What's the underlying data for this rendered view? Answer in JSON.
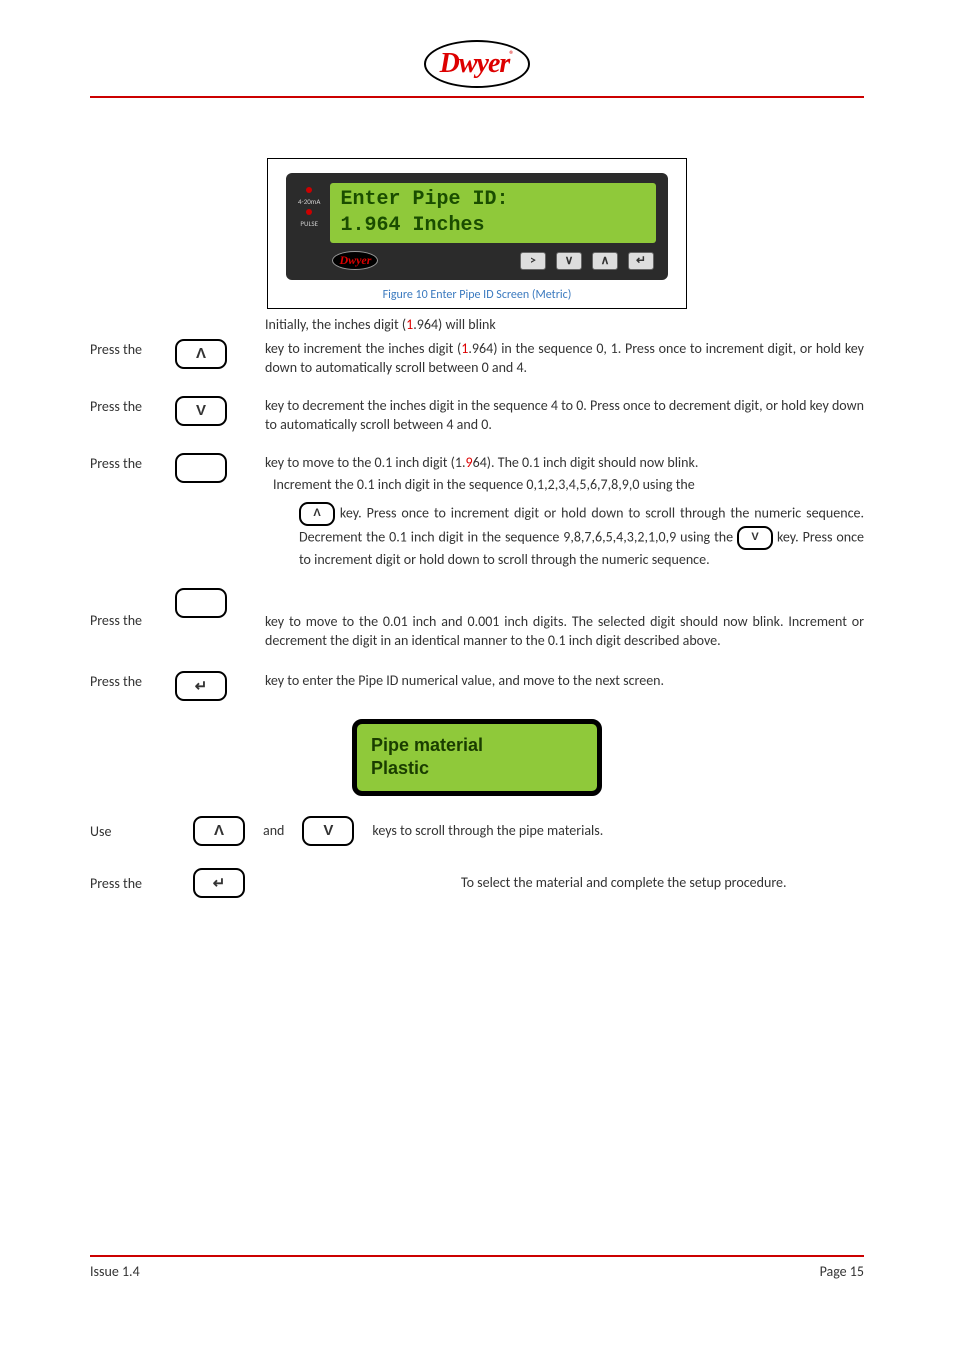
{
  "header": {
    "logo_text": "Dwyer",
    "logo_reg": "®"
  },
  "device": {
    "indicator1": "4-20mA",
    "indicator2": "PULSE",
    "lcd_line1": "Enter Pipe ID:",
    "lcd_line2": " 1.964 Inches",
    "mini_logo": "Dwyer",
    "btn_gt": ">",
    "btn_down": "∨",
    "btn_up": "∧",
    "btn_enter": "↵",
    "caption": "Figure 10 Enter Pipe ID Screen (Metric)"
  },
  "lines": {
    "initial": "Initially, the inches digit  (",
    "initial_red": "1",
    "initial_after": ".964) will blink",
    "press_the": "Press the",
    "use": "Use",
    "and": "and",
    "key_up": "Λ",
    "key_down": "V",
    "key_enter": "↵",
    "p1a": "key to increment the inches digit (",
    "p1_red": "1",
    "p1b": ".964) in the sequence 0, 1.  Press once to increment digit, or hold key down to automatically scroll between 0 and 4.",
    "p2": "key to decrement the inches digit in the sequence 4 to 0. Press once to decrement digit, or hold key down to automatically scroll between 4 and 0.",
    "p3a": "key to move to the 0.1 inch digit (1.",
    "p3_red": "9",
    "p3b": "64). The 0.1 inch digit should now blink.",
    "p3c": "Increment the 0.1 inch digit in the sequence 0,1,2,3,4,5,6,7,8,9,0 using the",
    "p3d": " key. Press once to increment digit or hold down to scroll through the numeric sequence. Decrement the 0.1 inch digit in the sequence 9,8,7,6,5,4,3,2,1,0,9 using the ",
    "p3e": " key.  Press once to increment digit or hold down to scroll through the numeric sequence.",
    "p4": "key to move to the 0.01 inch and 0.001 inch digits. The selected digit should now blink.  Increment or decrement the digit in an identical manner to the 0.1 inch digit described above.",
    "p5": "key to enter the Pipe ID numerical value, and move to the next screen.",
    "pipe_mat_l1": "Pipe material",
    "pipe_mat_l2": "Plastic",
    "p6": "keys to scroll through the pipe materials.",
    "p7": "To select the material and complete the setup procedure."
  },
  "footer": {
    "left": "Issue 1.4",
    "right": "Page 15"
  }
}
